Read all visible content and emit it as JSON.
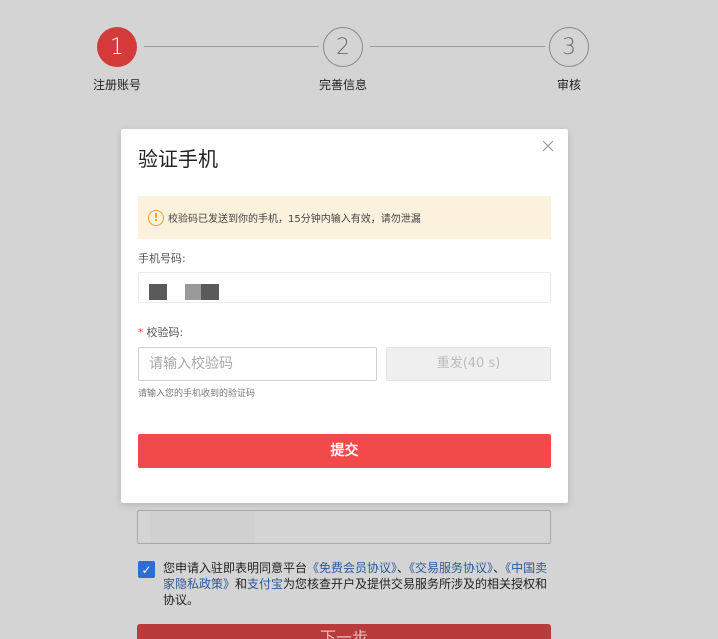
{
  "stepper": {
    "steps": [
      {
        "number": "1",
        "label": "注册账号",
        "state": "active"
      },
      {
        "number": "2",
        "label": "完善信息",
        "state": "inactive"
      },
      {
        "number": "3",
        "label": "审核",
        "state": "inactive"
      }
    ]
  },
  "background_form": {
    "agree_prefix": "您申请入驻即表明同意平台",
    "link1": "《免费会员协议》",
    "sep1": "、",
    "link2": "《交易服务协议》",
    "sep2": "、",
    "link3": "《中国卖家隐私政策》",
    "and": "和",
    "link4": "支付宝",
    "agree_suffix": "为您核查开户及提供交易服务所涉及的相关授权和协议。",
    "next_label": "下一步",
    "checkbox_checked": true
  },
  "modal": {
    "title": "验证手机",
    "close_icon": "close-icon",
    "notice": {
      "icon": "info-circle-icon",
      "text": "校验码已发送到你的手机，15分钟内输入有效，请勿泄漏"
    },
    "phone_label": "手机号码:",
    "code_label": "校验码:",
    "code_required_mark": "*",
    "code_placeholder": "请输入校验码",
    "code_value": "",
    "resend_label": "重发(40 s)",
    "hint": "请输入您的手机收到的验证码",
    "submit_label": "提交"
  },
  "colors": {
    "primary": "#f24a4a",
    "step_active": "#d43a3a",
    "link": "#2c5a9c",
    "notice_bg": "#fbf1dc",
    "overlay": "#d4d4d4"
  }
}
